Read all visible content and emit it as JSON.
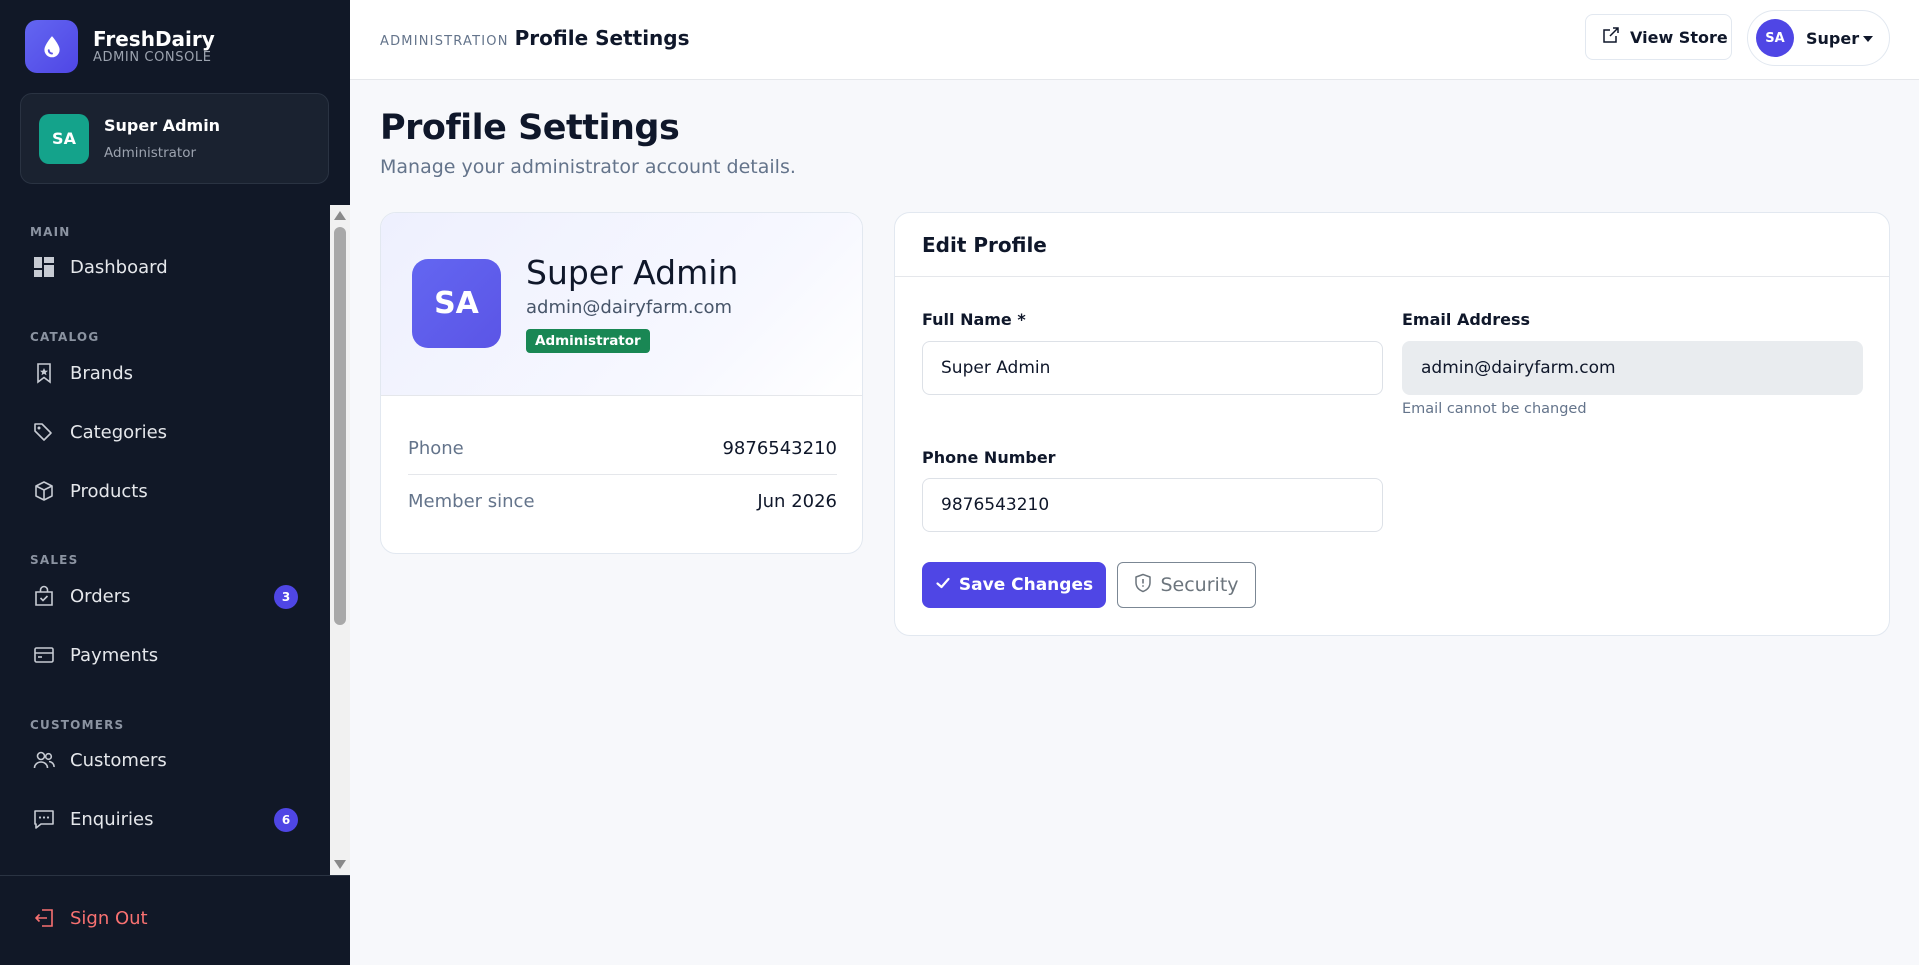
{
  "brand": {
    "name": "FreshDairy",
    "subtitle": "ADMIN CONSOLE"
  },
  "sidebar_user": {
    "initials": "SA",
    "name": "Super Admin",
    "role": "Administrator"
  },
  "nav": {
    "sections": {
      "main": "MAIN",
      "catalog": "CATALOG",
      "sales": "SALES",
      "customers": "CUSTOMERS"
    },
    "items": {
      "dashboard": {
        "label": "Dashboard",
        "icon": "dashboard-grid-icon"
      },
      "brands": {
        "label": "Brands",
        "icon": "bookmark-icon"
      },
      "categories": {
        "label": "Categories",
        "icon": "tag-icon"
      },
      "products": {
        "label": "Products",
        "icon": "box-icon"
      },
      "orders": {
        "label": "Orders",
        "icon": "bag-check-icon",
        "badge": "3"
      },
      "payments": {
        "label": "Payments",
        "icon": "credit-card-icon"
      },
      "customers": {
        "label": "Customers",
        "icon": "people-icon"
      },
      "enquiries": {
        "label": "Enquiries",
        "icon": "chat-icon",
        "badge": "6"
      }
    },
    "signout": {
      "label": "Sign Out",
      "icon": "sign-out-icon"
    }
  },
  "header": {
    "breadcrumb_small": "ADMINISTRATION",
    "breadcrumb_title": "Profile Settings",
    "view_store_label": "View Store",
    "profile_initials": "SA",
    "profile_name": "Super"
  },
  "page": {
    "title": "Profile Settings",
    "subtitle": "Manage your administrator account details."
  },
  "summary": {
    "initials": "SA",
    "name": "Super Admin",
    "email": "admin@dairyfarm.com",
    "badge": "Administrator",
    "phone_label": "Phone",
    "phone_value": "9876543210",
    "member_label": "Member since",
    "member_value": "Jun 2026"
  },
  "form": {
    "title": "Edit Profile",
    "full_name_label": "Full Name *",
    "full_name_value": "Super Admin",
    "email_label": "Email Address",
    "email_value": "admin@dairyfarm.com",
    "email_help": "Email cannot be changed",
    "phone_label": "Phone Number",
    "phone_value": "9876543210",
    "save_label": "Save Changes",
    "security_label": "Security"
  },
  "colors": {
    "sidebar_bg": "#111827",
    "accent": "#4f46e5",
    "success": "#198754",
    "danger": "#f87171"
  }
}
